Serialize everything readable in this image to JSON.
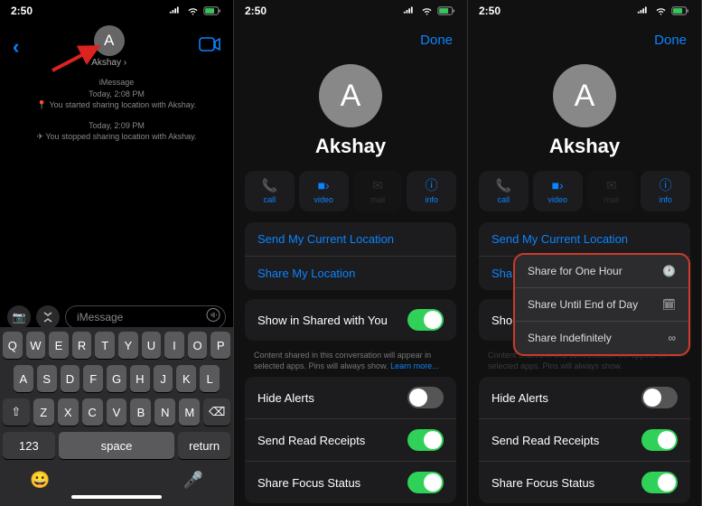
{
  "time": "2:50",
  "p1": {
    "contact": "Akshay",
    "service": "iMessage",
    "ts1": "Today, 2:08 PM",
    "line1": "You started sharing location with Akshay.",
    "ts2": "Today, 2:09 PM",
    "line2": "You stopped sharing location with Akshay.",
    "placeholder": "iMessage",
    "keys_r1": [
      "Q",
      "W",
      "E",
      "R",
      "T",
      "Y",
      "U",
      "I",
      "O",
      "P"
    ],
    "keys_r2": [
      "A",
      "S",
      "D",
      "F",
      "G",
      "H",
      "J",
      "K",
      "L"
    ],
    "keys_r3": [
      "Z",
      "X",
      "C",
      "V",
      "B",
      "N",
      "M"
    ],
    "key_num": "123",
    "key_space": "space",
    "key_return": "return"
  },
  "detail": {
    "done": "Done",
    "contact": "Akshay",
    "actions": [
      {
        "label": "call"
      },
      {
        "label": "video"
      },
      {
        "label": "mail"
      },
      {
        "label": "info"
      }
    ],
    "send_loc": "Send My Current Location",
    "share_loc": "Share My Location",
    "show_shared": "Show in Shared with You",
    "hint": "Content shared in this conversation will appear in selected apps. Pins will always show.",
    "learn_more": "Learn more...",
    "hide_alerts": "Hide Alerts",
    "read_receipts": "Send Read Receipts",
    "focus_status": "Share Focus Status",
    "show_trunc": "Show"
  },
  "popup": {
    "opt1": "Share for One Hour",
    "opt2": "Share Until End of Day",
    "opt3": "Share Indefinitely"
  }
}
